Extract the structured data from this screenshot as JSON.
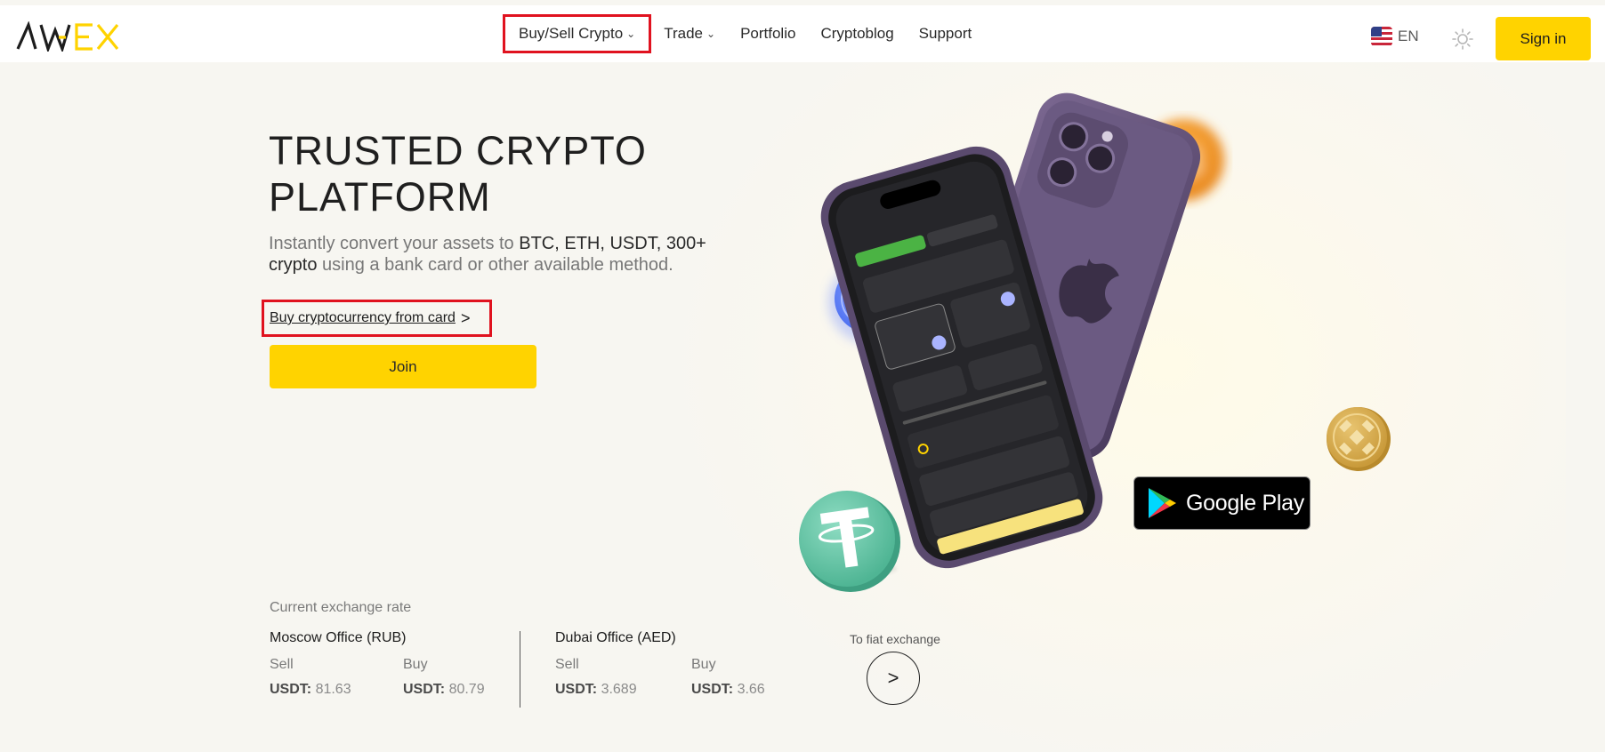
{
  "header": {
    "logo_text": "AWEX",
    "nav": [
      {
        "label": "Buy/Sell Crypto",
        "has_chevron": true
      },
      {
        "label": "Trade",
        "has_chevron": true
      },
      {
        "label": "Portfolio"
      },
      {
        "label": "Cryptoblog"
      },
      {
        "label": "Support"
      }
    ],
    "language": "EN",
    "signin_label": "Sign in",
    "icons": {
      "flag": "us-flag-icon",
      "theme": "sun-icon",
      "chevron": "chevron-down-icon"
    }
  },
  "hero": {
    "title_line1": "TRUSTED CRYPTO",
    "title_line2": "PLATFORM",
    "subtitle_part1": "Instantly convert your assets to ",
    "subtitle_highlight": "BTC, ETH, USDT, 300+ crypto",
    "subtitle_part2": " using a bank card or other available method.",
    "buy_link": "Buy cryptocurrency from card",
    "buy_link_arrow": ">",
    "join_label": "Join"
  },
  "google_play": {
    "label": "Google Play"
  },
  "rates": {
    "title": "Current exchange rate",
    "offices": [
      {
        "name": "Moscow Office (RUB)",
        "sell_label": "Sell",
        "buy_label": "Buy",
        "currency": "USDT:",
        "sell": "81.63",
        "buy": "80.79"
      },
      {
        "name": "Dubai Office (AED)",
        "sell_label": "Sell",
        "buy_label": "Buy",
        "currency": "USDT:",
        "sell": "3.689",
        "buy": "3.66"
      }
    ],
    "fiat_label": "To fiat exchange",
    "fiat_arrow": ">"
  },
  "colors": {
    "accent": "#ffd300",
    "highlight_border": "#e0121f",
    "background": "#f7f6f1"
  }
}
